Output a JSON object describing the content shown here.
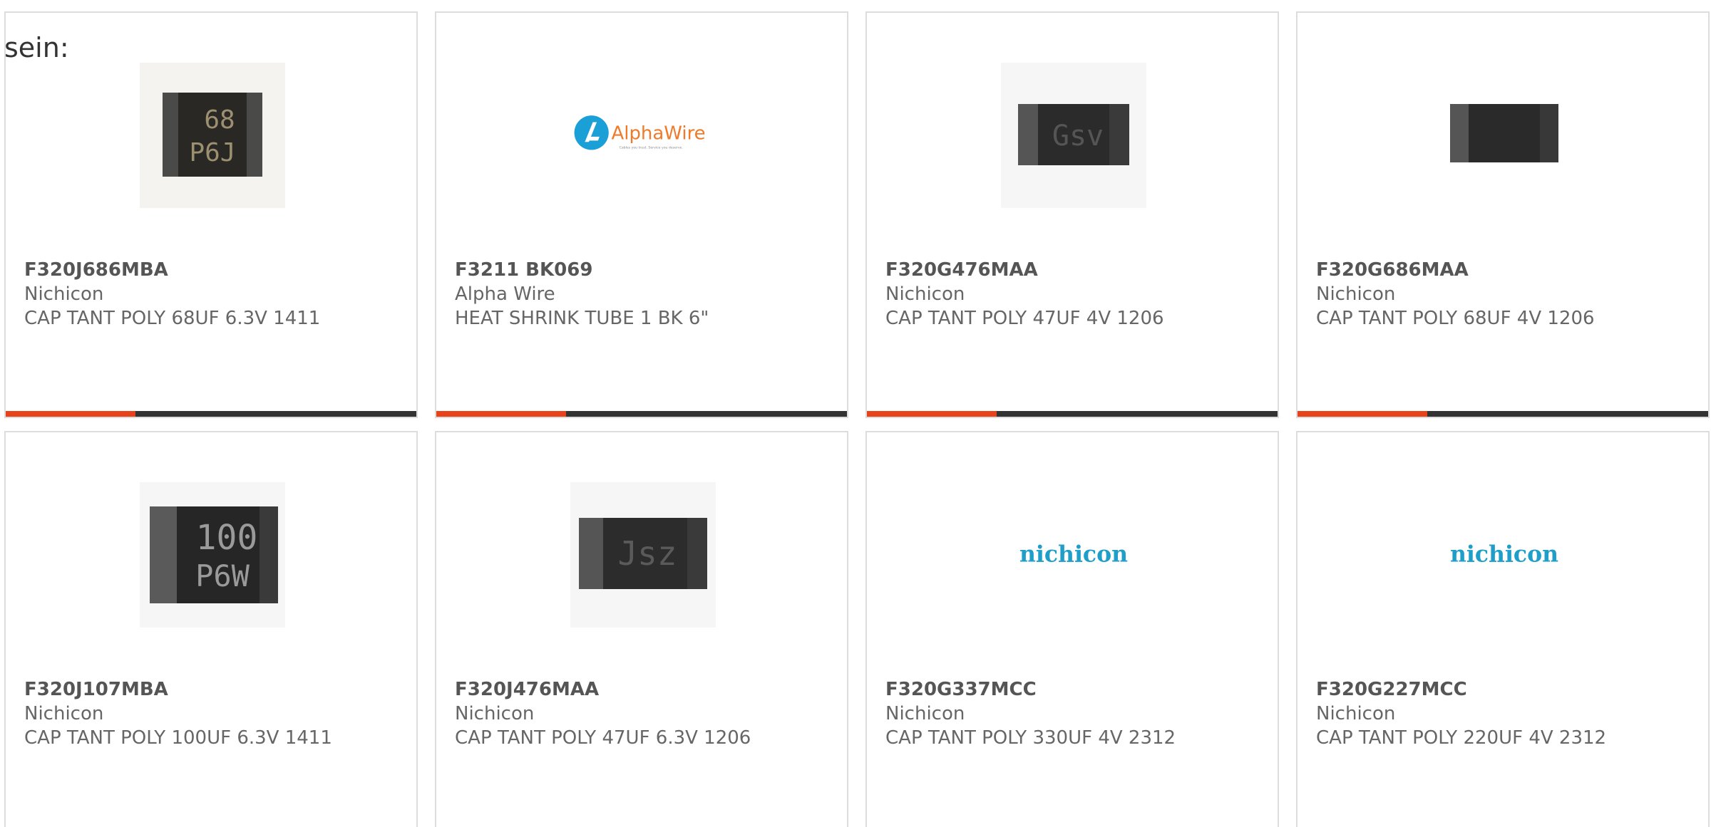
{
  "intro_text": "sein:",
  "accent_color": "#e8421a",
  "products": [
    {
      "part_number": "F320J686MBA",
      "manufacturer": "Nichicon",
      "description": "CAP TANT POLY 68UF 6.3V 1411",
      "image": {
        "type": "chip-capacitor",
        "marking_line1": "68",
        "marking_line2": "P6J"
      }
    },
    {
      "part_number": "F3211 BK069",
      "manufacturer": "Alpha Wire",
      "description": "HEAT SHRINK TUBE 1 BK 6\"",
      "image": {
        "type": "logo",
        "logo_text": "AlphaWire",
        "logo_tagline": "Cables you trust. Service you deserve."
      }
    },
    {
      "part_number": "F320G476MAA",
      "manufacturer": "Nichicon",
      "description": "CAP TANT POLY 47UF 4V 1206",
      "image": {
        "type": "chip-capacitor",
        "marking_line1": "Gsv"
      }
    },
    {
      "part_number": "F320G686MAA",
      "manufacturer": "Nichicon",
      "description": "CAP TANT POLY 68UF 4V 1206",
      "image": {
        "type": "chip-capacitor",
        "marking_line1": ""
      }
    },
    {
      "part_number": "F320J107MBA",
      "manufacturer": "Nichicon",
      "description": "CAP TANT POLY 100UF 6.3V 1411",
      "image": {
        "type": "chip-capacitor",
        "marking_line1": "100",
        "marking_line2": "P6W"
      }
    },
    {
      "part_number": "F320J476MAA",
      "manufacturer": "Nichicon",
      "description": "CAP TANT POLY 47UF 6.3V 1206",
      "image": {
        "type": "chip-capacitor",
        "marking_line1": "Jsz"
      }
    },
    {
      "part_number": "F320G337MCC",
      "manufacturer": "Nichicon",
      "description": "CAP TANT POLY 330UF 4V 2312",
      "image": {
        "type": "logo",
        "logo_text": "nichicon"
      }
    },
    {
      "part_number": "F320G227MCC",
      "manufacturer": "Nichicon",
      "description": "CAP TANT POLY 220UF 4V 2312",
      "image": {
        "type": "logo",
        "logo_text": "nichicon"
      }
    }
  ]
}
